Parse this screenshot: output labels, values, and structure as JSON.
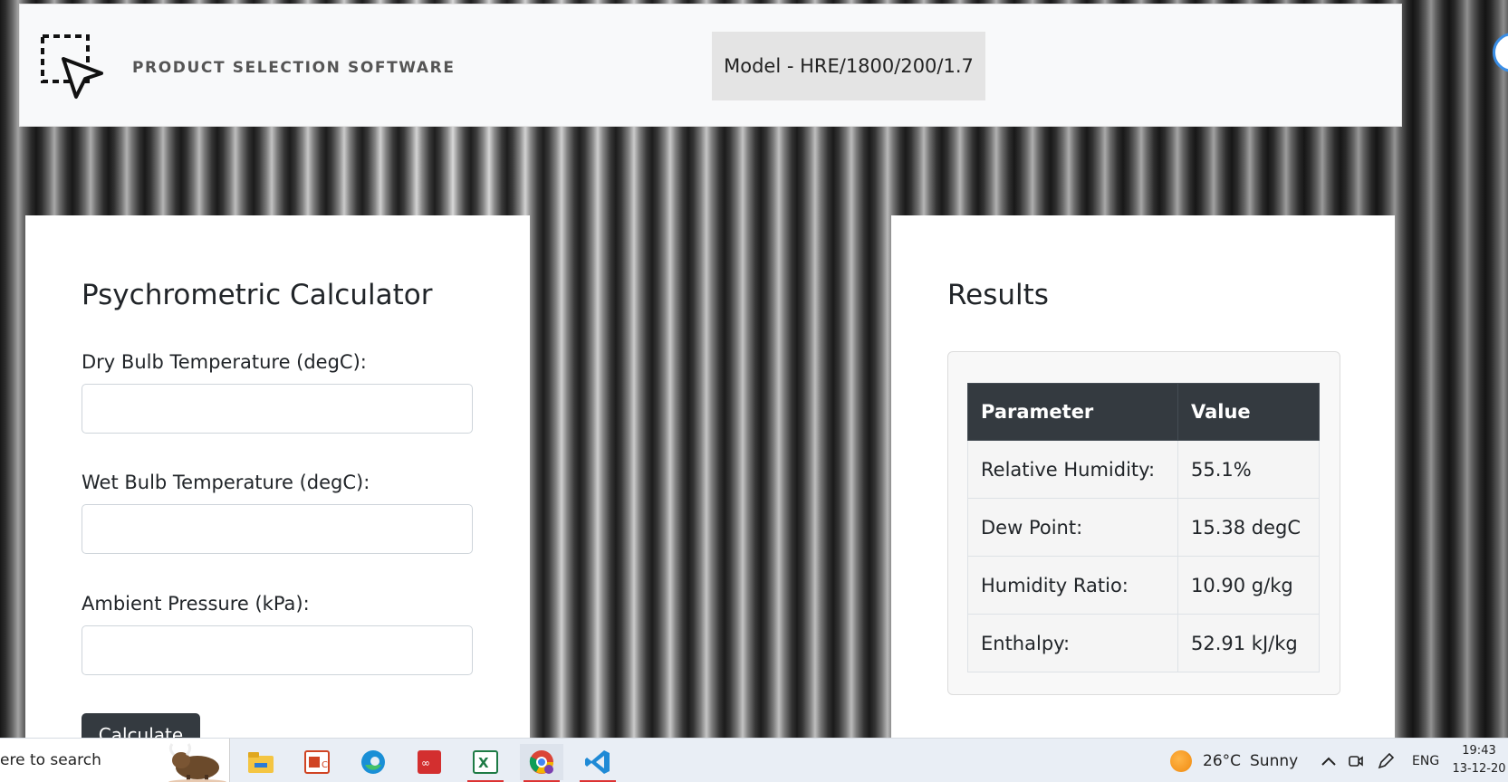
{
  "header": {
    "brand": "PRODUCT SELECTION SOFTWARE",
    "model": "Model - HRE/1800/200/1.7"
  },
  "calculator": {
    "title": "Psychrometric Calculator",
    "fields": [
      {
        "label": "Dry Bulb Temperature (degC):",
        "value": ""
      },
      {
        "label": "Wet Bulb Temperature (degC):",
        "value": ""
      },
      {
        "label": "Ambient Pressure (kPa):",
        "value": ""
      }
    ],
    "button": "Calculate"
  },
  "results": {
    "title": "Results",
    "headers": [
      "Parameter",
      "Value"
    ],
    "rows": [
      {
        "param": "Relative Humidity:",
        "value": "55.1%"
      },
      {
        "param": "Dew Point:",
        "value": "15.38 degC"
      },
      {
        "param": "Humidity Ratio:",
        "value": "10.90 g/kg"
      },
      {
        "param": "Enthalpy:",
        "value": "52.91 kJ/kg"
      }
    ]
  },
  "taskbar": {
    "search_text": "ere to search",
    "apps": [
      "file-explorer-icon",
      "powerpoint-icon",
      "edge-icon",
      "arduino-icon",
      "excel-icon",
      "chrome-icon",
      "vscode-icon"
    ],
    "weather": {
      "temp": "26°C",
      "condition": "Sunny"
    },
    "language": "ENG",
    "time": "19:43",
    "date": "13-12-20"
  },
  "colors": {
    "header_bg": "#f8f9fa",
    "dark": "#343a40",
    "badge_bg": "#e4e4e4"
  }
}
